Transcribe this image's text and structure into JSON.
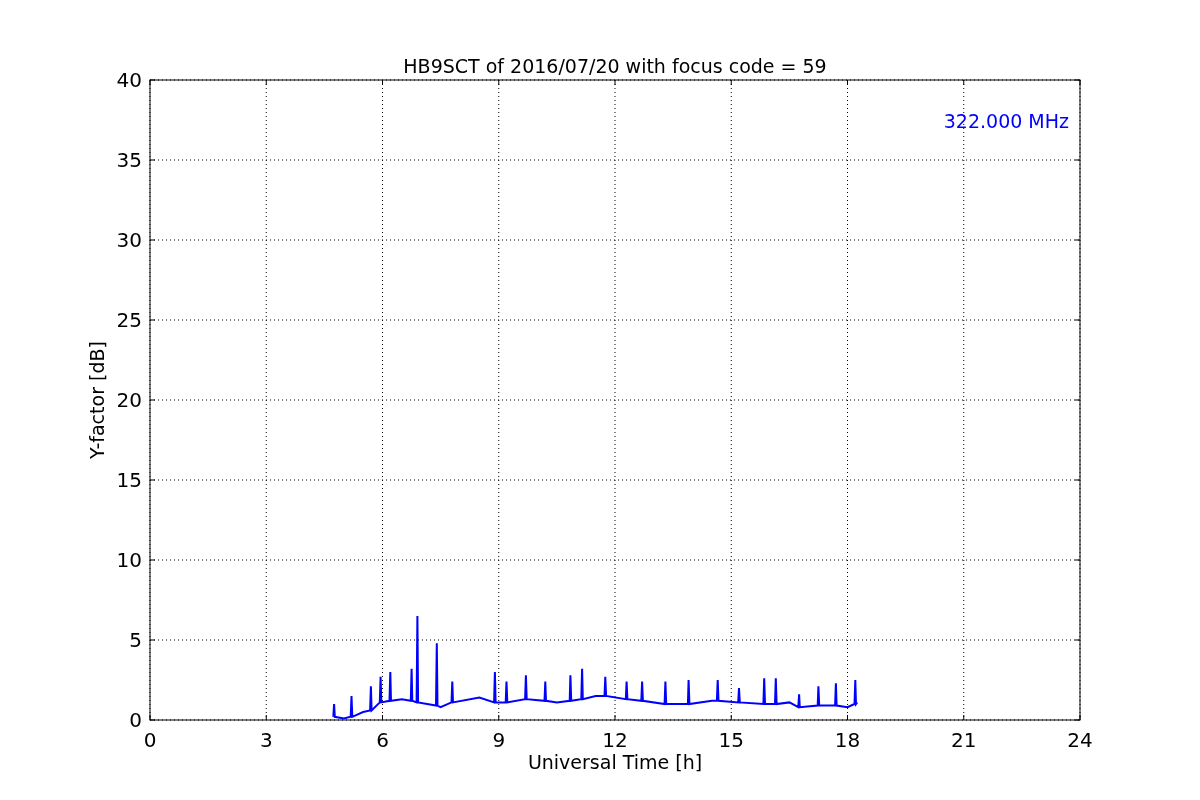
{
  "chart_data": {
    "type": "line",
    "title": "HB9SCT of 2016/07/20 with focus code = 59",
    "xlabel": "Universal Time [h]",
    "ylabel": "Y-factor [dB]",
    "xlim": [
      0,
      24
    ],
    "ylim": [
      0,
      40
    ],
    "xticks": [
      0,
      3,
      6,
      9,
      12,
      15,
      18,
      21,
      24
    ],
    "yticks": [
      0,
      5,
      10,
      15,
      20,
      25,
      30,
      35,
      40
    ],
    "x": [
      4.73,
      4.75,
      4.77,
      5.0,
      5.18,
      5.2,
      5.22,
      5.5,
      5.68,
      5.7,
      5.72,
      5.93,
      5.95,
      5.97,
      6.18,
      6.2,
      6.22,
      6.5,
      6.73,
      6.75,
      6.77,
      6.88,
      6.9,
      6.92,
      7.38,
      7.4,
      7.42,
      7.5,
      7.78,
      7.8,
      7.82,
      8.5,
      8.88,
      8.9,
      8.92,
      9.18,
      9.2,
      9.22,
      9.68,
      9.7,
      9.72,
      10.18,
      10.2,
      10.22,
      10.5,
      10.83,
      10.85,
      10.87,
      11.13,
      11.15,
      11.17,
      11.5,
      11.73,
      11.75,
      11.77,
      12.28,
      12.3,
      12.32,
      12.68,
      12.7,
      12.72,
      13.28,
      13.3,
      13.32,
      13.88,
      13.9,
      13.92,
      14.5,
      14.63,
      14.65,
      14.67,
      15.18,
      15.2,
      15.22,
      15.83,
      15.85,
      15.87,
      16.13,
      16.15,
      16.17,
      16.5,
      16.73,
      16.75,
      16.77,
      17.23,
      17.25,
      17.27,
      17.68,
      17.7,
      17.72,
      18.0,
      18.18,
      18.2,
      18.22,
      18.25
    ],
    "series": [
      {
        "name": "322.000 MHz",
        "color": "#0000ff",
        "values": [
          0.2,
          1.0,
          0.2,
          0.1,
          0.2,
          1.5,
          0.2,
          0.5,
          0.6,
          2.1,
          0.6,
          1.1,
          2.7,
          1.1,
          1.2,
          3.0,
          1.2,
          1.3,
          1.2,
          3.2,
          1.2,
          1.1,
          6.5,
          1.1,
          0.9,
          4.8,
          0.9,
          0.8,
          1.1,
          2.4,
          1.1,
          1.4,
          1.1,
          3.0,
          1.1,
          1.1,
          2.4,
          1.1,
          1.3,
          2.8,
          1.3,
          1.2,
          2.4,
          1.2,
          1.1,
          1.2,
          2.8,
          1.2,
          1.3,
          3.2,
          1.3,
          1.5,
          1.5,
          2.7,
          1.5,
          1.3,
          2.4,
          1.3,
          1.2,
          2.4,
          1.2,
          1.0,
          2.4,
          1.0,
          1.0,
          2.5,
          1.0,
          1.2,
          1.2,
          2.5,
          1.2,
          1.1,
          2.0,
          1.1,
          1.0,
          2.6,
          1.0,
          1.0,
          2.6,
          1.0,
          1.1,
          0.8,
          1.6,
          0.8,
          0.9,
          2.1,
          0.9,
          0.9,
          2.3,
          0.9,
          0.8,
          1.0,
          2.5,
          1.0,
          1.1
        ]
      }
    ],
    "grid": true
  }
}
